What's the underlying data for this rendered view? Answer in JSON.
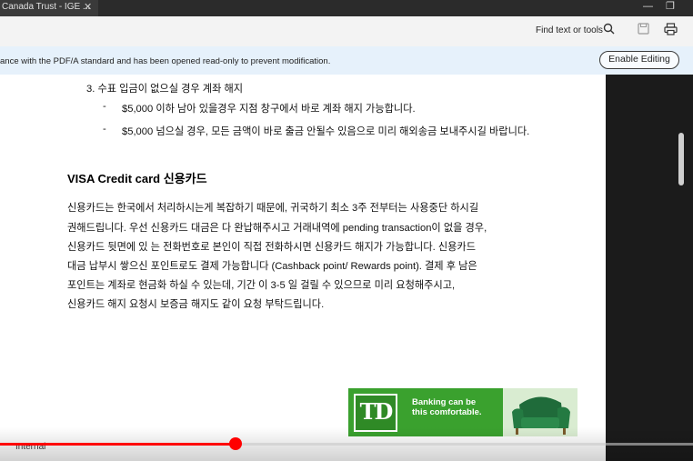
{
  "window": {
    "tab_title": "Canada Trust - IGE ...",
    "tab_close": "✕",
    "minimize": "—",
    "restore": "❐"
  },
  "toolbar": {
    "find_label": "Find text or tools",
    "search_icon": "search-icon",
    "save_icon": "save-icon",
    "print_icon": "print-icon"
  },
  "notice": {
    "text": "ance with the PDF/A standard and has been opened read-only to prevent modification.",
    "enable_button": "Enable Editing"
  },
  "document": {
    "list_item": "3.   수표 입금이 없으실 경우 계좌 해지",
    "bullets": [
      {
        "dash": "-",
        "text": "$5,000 이하 남아 있을경우 지점 창구에서 바로 계좌 해지 가능합니다."
      },
      {
        "dash": "-",
        "text": "$5,000 넘으실 경우, 모든 금액이 바로 출금 안될수 있음으로 미리 해외송금 보내주시길 바랍니다."
      }
    ],
    "heading": "VISA Credit card 신용카드",
    "paragraph_lines": [
      "신용카드는 한국에서 처리하시는게 복잡하기 때문에, 귀국하기 최소 3주 전부터는 사용중단 하시길",
      "권해드립니다. 우선 신용카드 대금은 다 완납해주시고 거래내역에 pending transaction이 없을 경우,",
      "신용카드 뒷면에 있 는 전화번호로 본인이 직접 전화하시면 신용카드 해지가 가능합니다. 신용카드",
      "대금 납부시 쌓으신 포인트로도 결제 가능합니다 (Cashback point/ Rewards point). 결제 후 남은",
      "포인트는 계좌로 현금화 하실 수 있는데, 기간 이 3-5 일 걸릴 수 있으므로 미리 요청해주시고,",
      "신용카드 해지 요청시 보증금 해지도 같이 요청 부탁드립니다."
    ]
  },
  "ad": {
    "logo": "TD",
    "tagline_line1": "Banking can be",
    "tagline_line2": "this comfortable."
  },
  "footer": {
    "label": "Internal"
  },
  "video": {
    "progress_fraction": 0.34,
    "played_color": "#ff0000"
  },
  "colors": {
    "notice_bg": "#e6f1fb",
    "td_green": "#3aa12e"
  }
}
